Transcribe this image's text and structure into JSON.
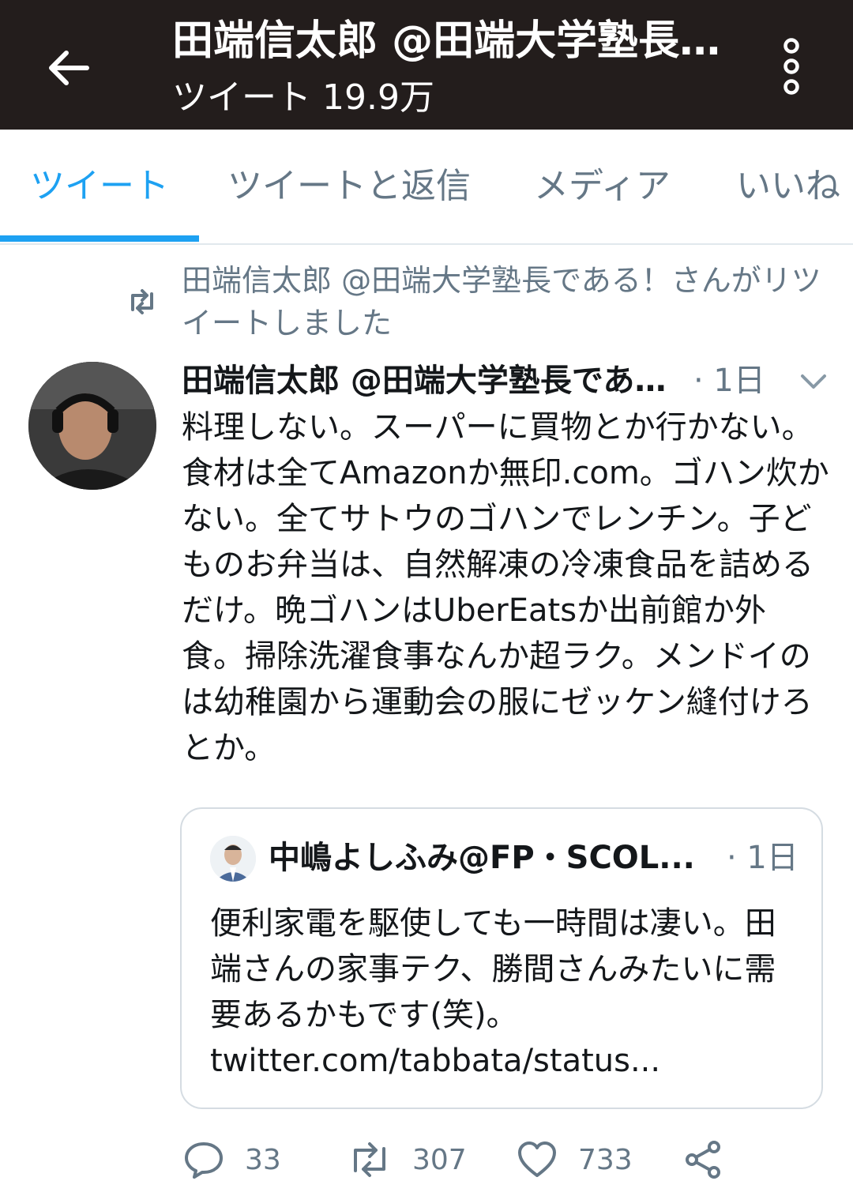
{
  "header": {
    "title": "田端信太郎 @田端大学塾長である！",
    "subtitle": "ツイート 19.9万"
  },
  "tabs": [
    {
      "label": "ツイート"
    },
    {
      "label": "ツイートと返信"
    },
    {
      "label": "メディア"
    },
    {
      "label": "いいね"
    }
  ],
  "retweet_notice": "田端信太郎 @田端大学塾長である！さんがリツイートしました",
  "tweet": {
    "author": "田端信太郎 @田端大学塾長である！",
    "time": "· 1日",
    "text": "料理しない。スーパーに買物とか行かない。食材は全てAmazonか無印.com。ゴハン炊かない。全てサトウのゴハンでレンチン。子どものお弁当は、自然解凍の冷凍食品を詰めるだけ。晩ゴハンはUberEatsか出前館か外食。掃除洗濯食事なんか超ラク。メンドイのは幼稚園から運動会の服にゼッケン縫付けろとか。"
  },
  "quote": {
    "author": "中嶋よしふみ@FP・SCOL...",
    "time": "· 1日",
    "text": "便利家電を駆使しても一時間は凄い。田端さんの家事テク、勝間さんみたいに需要あるかもです(笑)。",
    "link": "twitter.com/tabbata/status..."
  },
  "actions": {
    "replies": "33",
    "retweets": "307",
    "likes": "733"
  },
  "colors": {
    "topbar": "#231d1c",
    "accent": "#1da1f2",
    "muted": "#657786"
  }
}
